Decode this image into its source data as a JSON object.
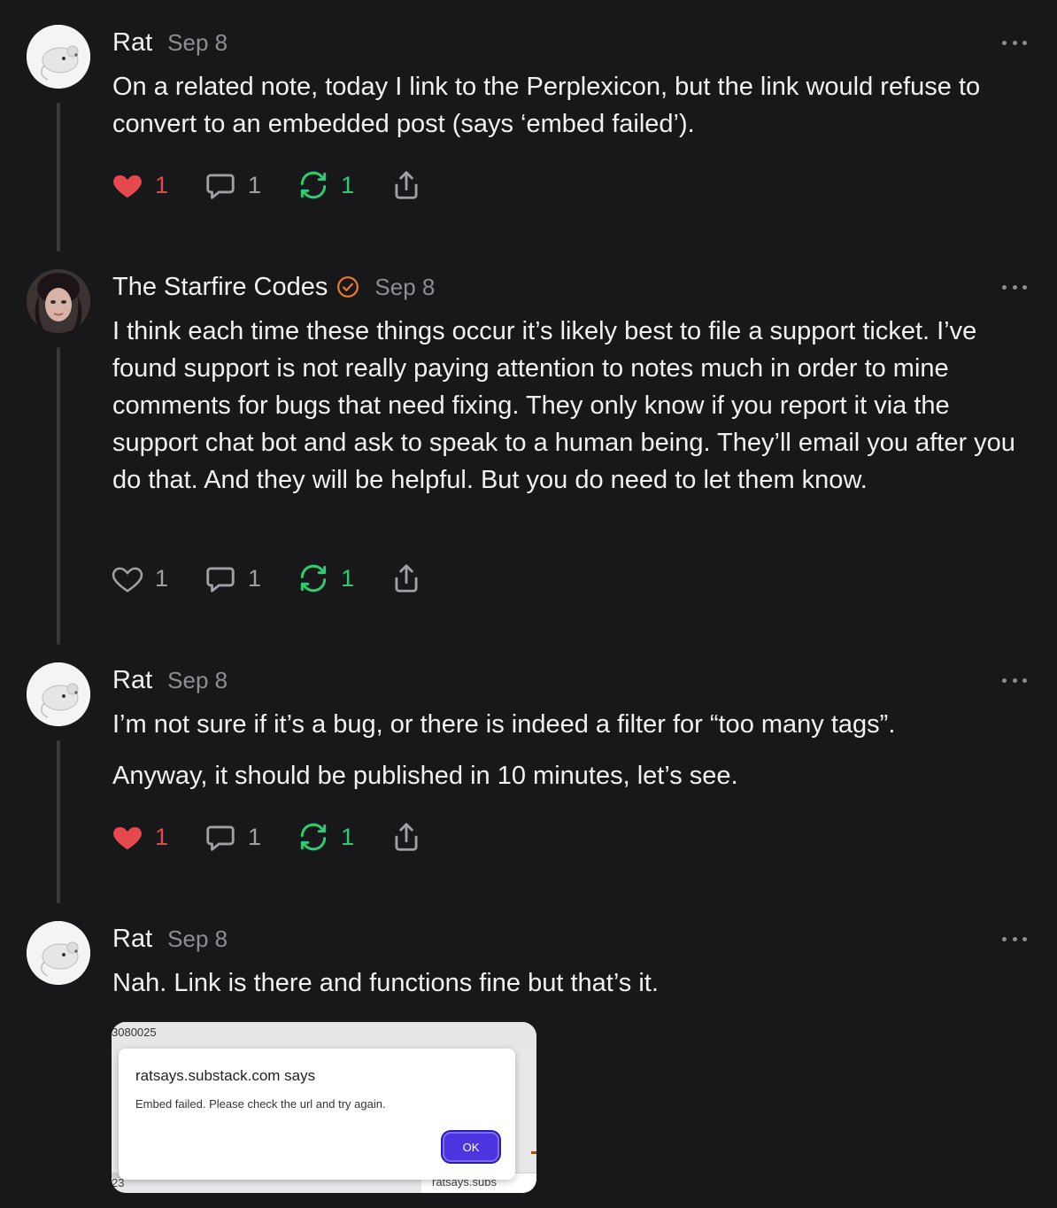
{
  "comments": [
    {
      "author": "Rat",
      "date": "Sep 8",
      "paragraphs": [
        "On a related note, today I link to the Perplexicon, but the link would refuse to convert to an embedded post (says ‘embed failed’)."
      ],
      "likes": "1",
      "comments": "1",
      "restacks": "1",
      "liked": true
    },
    {
      "author": "The Starfire Codes",
      "date": "Sep 8",
      "verified": true,
      "paragraphs": [
        "I think each time these things occur it’s likely best to file a support ticket. I’ve found support is not really paying attention to notes much in order to mine comments for bugs that need fixing. They only know if you report it via the support chat bot and ask to speak to a human being. They’ll email you after you do that. And they will be helpful. But you do need to let them know."
      ],
      "likes": "1",
      "comments": "1",
      "restacks": "1",
      "liked": false
    },
    {
      "author": "Rat",
      "date": "Sep 8",
      "paragraphs": [
        "I’m not sure if it’s a bug, or there is indeed a filter for “too many tags”.",
        "Anyway, it should be published in 10 minutes, let’s see."
      ],
      "likes": "1",
      "comments": "1",
      "restacks": "1",
      "liked": true
    },
    {
      "author": "Rat",
      "date": "Sep 8",
      "paragraphs": [
        "Nah. Link is there and functions fine but that’s it."
      ]
    }
  ],
  "screenshot": {
    "top_text": "3080025",
    "dialog_title": "ratsays.substack.com says",
    "dialog_message": "Embed failed. Please check the url and try again.",
    "ok_label": "OK",
    "bottom_left_text": "23",
    "bottom_tab_text": "ratsays.subs"
  },
  "colors": {
    "background": "#18181b",
    "like_red": "#e5484d",
    "restack_green": "#2ecc71",
    "verified_orange": "#f07c24",
    "muted": "#8d8d93"
  }
}
